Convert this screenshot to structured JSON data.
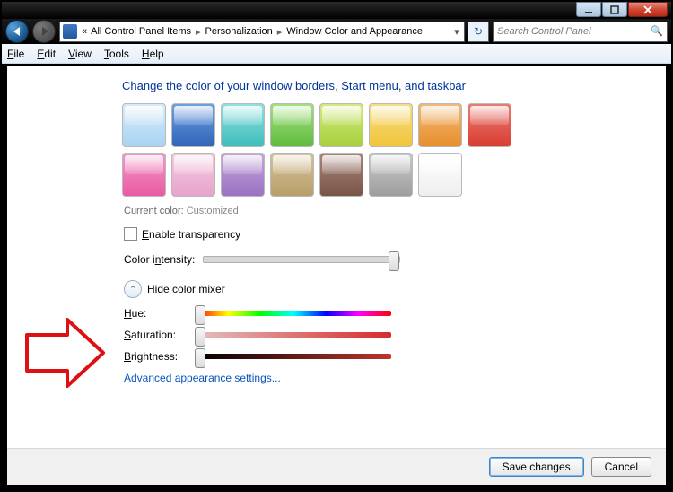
{
  "titlebar": {
    "min_icon": "minimize-icon",
    "max_icon": "maximize-icon",
    "close_icon": "close-icon"
  },
  "nav": {
    "back_icon": "back-icon",
    "forward_icon": "forward-icon",
    "refresh_glyph": "↻"
  },
  "address": {
    "overflow": "«",
    "crumbs": [
      "All Control Panel Items",
      "Personalization",
      "Window Color and Appearance"
    ],
    "sep": "▸",
    "drop": "▾"
  },
  "search": {
    "placeholder": "Search Control Panel"
  },
  "menus": {
    "file": "File",
    "edit": "Edit",
    "view": "View",
    "tools": "Tools",
    "help": "Help"
  },
  "page": {
    "heading": "Change the color of your window borders, Start menu, and taskbar",
    "swatches": [
      {
        "name": "sky",
        "c1": "#d8ecfa",
        "c2": "#a9d4f2"
      },
      {
        "name": "twilight",
        "c1": "#6f9fe0",
        "c2": "#2f64b8"
      },
      {
        "name": "sea",
        "c1": "#8fe0df",
        "c2": "#3fbdbb"
      },
      {
        "name": "leaf",
        "c1": "#a4e07f",
        "c2": "#5fbc3e"
      },
      {
        "name": "lime",
        "c1": "#d3ea7c",
        "c2": "#a7cf3e"
      },
      {
        "name": "sun",
        "c1": "#f7dd82",
        "c2": "#f1c53a"
      },
      {
        "name": "pumpkin",
        "c1": "#f3b977",
        "c2": "#e78f2c"
      },
      {
        "name": "ruby",
        "c1": "#ea7a72",
        "c2": "#d83e32"
      },
      {
        "name": "fuchsia",
        "c1": "#f397c7",
        "c2": "#e85aa4"
      },
      {
        "name": "blush",
        "c1": "#f3c9e0",
        "c2": "#e7a4cc"
      },
      {
        "name": "violet",
        "c1": "#c3a6dc",
        "c2": "#9a72c3"
      },
      {
        "name": "taupe",
        "c1": "#d4c29b",
        "c2": "#b99e6a"
      },
      {
        "name": "chocolate",
        "c1": "#a7857a",
        "c2": "#795547"
      },
      {
        "name": "slate",
        "c1": "#c9c9c9",
        "c2": "#9e9e9e"
      },
      {
        "name": "frost",
        "c1": "#ffffff",
        "c2": "#eeeeee"
      }
    ],
    "current_color_label": "Current color:",
    "current_color_value": "Customized",
    "transparency_label": "Enable transparency",
    "transparency_checked": false,
    "intensity_label": "Color intensity:",
    "intensity_value": 0.97,
    "mixer_toggle": "Hide color mixer",
    "mixer_chevron": "⌃",
    "sliders": {
      "hue_label": "Hue:",
      "hue_value": 0.02,
      "sat_label": "Saturation:",
      "sat_value": 0.02,
      "bri_label": "Brightness:",
      "bri_value": 0.02
    },
    "advanced_link": "Advanced appearance settings..."
  },
  "footer": {
    "save": "Save changes",
    "cancel": "Cancel"
  }
}
